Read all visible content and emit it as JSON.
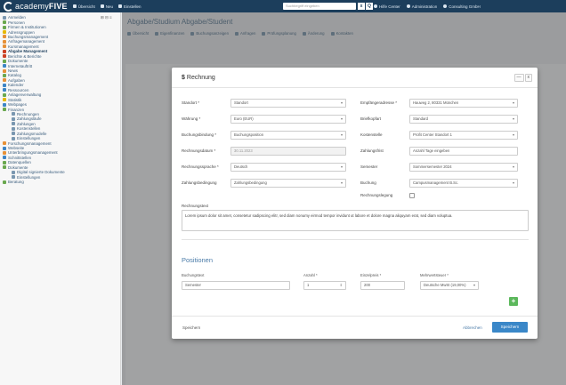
{
  "topbar": {
    "brand_main": "academy",
    "brand_five": "FIVE",
    "nav": [
      "Übersicht",
      "Neu",
      "Einstellen"
    ],
    "search_placeholder": "Suchbegriff eingeben",
    "search_btn_1": "x",
    "search_btn_2": "Q",
    "right": [
      "Hilfe Center",
      "Administration",
      "Consulting GmbH"
    ]
  },
  "sidebar": {
    "tools": "⊞ ⊟ ≡",
    "items": [
      {
        "label": "Anmelden",
        "color": "#7a97b0",
        "bold": false
      },
      {
        "label": "Personen",
        "color": "#6aa84f",
        "bold": false
      },
      {
        "label": "Firmen & Institutionen",
        "color": "#6aa84f",
        "bold": false
      },
      {
        "label": "Adressgruppen",
        "color": "#e6b800",
        "bold": false
      },
      {
        "label": "Buchungsmanagement",
        "color": "#e69138",
        "bold": false
      },
      {
        "label": "Anfragemanagement",
        "color": "#e69138",
        "bold": false
      },
      {
        "label": "Kursmanagement",
        "color": "#e69138",
        "bold": false
      },
      {
        "label": "Abgabe Management",
        "color": "#cc4125",
        "bold": true
      },
      {
        "label": "Berichte & Berichte",
        "color": "#cc4125",
        "bold": false
      },
      {
        "label": "Dokumente",
        "color": "#6aa84f",
        "bold": false
      },
      {
        "label": "Internetauftritt",
        "color": "#3d85c6",
        "bold": false
      },
      {
        "label": "News",
        "color": "#e69138",
        "bold": false
      },
      {
        "label": "Katalog",
        "color": "#6aa84f",
        "bold": false
      },
      {
        "label": "Aufgaben",
        "color": "#e69138",
        "bold": false
      },
      {
        "label": "Kalender",
        "color": "#3d85c6",
        "bold": false
      },
      {
        "label": "Ressourcen",
        "color": "#3d85c6",
        "bold": false
      },
      {
        "label": "Anlagenverwaltung",
        "color": "#6aa84f",
        "bold": false
      },
      {
        "label": "Statistik",
        "color": "#e6b800",
        "bold": false
      },
      {
        "label": "Webpages",
        "color": "#3d85c6",
        "bold": false
      },
      {
        "label": "Finanzen",
        "color": "#6aa84f",
        "bold": false
      },
      {
        "label": "Rechnungen",
        "color": "#7a97b0",
        "bold": false
      },
      {
        "label": "Zahlungsläufe",
        "color": "#7a97b0",
        "bold": false
      },
      {
        "label": "Zahlungen",
        "color": "#7a97b0",
        "bold": false
      },
      {
        "label": "Kostenstellen",
        "color": "#7a97b0",
        "bold": false
      },
      {
        "label": "Zahlungsmodelle",
        "color": "#7a97b0",
        "bold": false
      },
      {
        "label": "Einstellungen",
        "color": "#7a97b0",
        "bold": false
      },
      {
        "label": "Forschungsmanagement",
        "color": "#e69138",
        "bold": false
      },
      {
        "label": "Webseite",
        "color": "#3d85c6",
        "bold": false
      },
      {
        "label": "Unterbringungsmanagement",
        "color": "#e69138",
        "bold": false
      },
      {
        "label": "Schnittstellen",
        "color": "#3d85c6",
        "bold": false
      },
      {
        "label": "Datenquellen",
        "color": "#6aa84f",
        "bold": false
      },
      {
        "label": "Dokumente",
        "color": "#6aa84f",
        "bold": false
      },
      {
        "label": "Digital signierte Dokumente",
        "color": "#7a97b0",
        "bold": false
      },
      {
        "label": "Einstellungen",
        "color": "#7a97b0",
        "bold": false
      },
      {
        "label": "Beratung",
        "color": "#6aa84f",
        "bold": false
      }
    ]
  },
  "main": {
    "title": "Abgabe/Studium Abgabe/Student",
    "subtabs": [
      "Übersicht",
      "Eigenfinanzen",
      "Buchungsanzeigen",
      "Anfragen",
      "Prüfungsplanung",
      "Änderung",
      "Kontakten"
    ]
  },
  "modal": {
    "title": "Rechnung",
    "euro_symbol": "$",
    "hdr_btn_1": "—",
    "hdr_btn_2": "x",
    "left_fields": [
      {
        "label": "Standort *",
        "value": "Standort",
        "select": true,
        "disabled": false
      },
      {
        "label": "Währung *",
        "value": "Euro (EUR)",
        "select": true,
        "disabled": false
      },
      {
        "label": "Buchungsbindung *",
        "value": "Buchungsposition",
        "select": true,
        "disabled": false
      },
      {
        "label": "Rechnungsdatum *",
        "value": "30.11.2023",
        "select": false,
        "disabled": true
      },
      {
        "label": "Rechnungssprache *",
        "value": "Deutsch",
        "select": true,
        "disabled": false
      },
      {
        "label": "Zahlungsbedingung",
        "value": "Zahlungsbedingung",
        "select": true,
        "disabled": false
      }
    ],
    "right_fields": [
      {
        "label": "Empfängeradresse *",
        "value": "Hauweg 2, 80331 München",
        "select": true,
        "disabled": false
      },
      {
        "label": "Briefkopfart",
        "value": "Standard",
        "select": true,
        "disabled": false
      },
      {
        "label": "Kostenstelle",
        "value": "Profit Center Standort 1",
        "select": true,
        "disabled": false
      },
      {
        "label": "Zahlungsfrist",
        "value": "Anzahl Tage eingeben",
        "select": false,
        "disabled": false
      },
      {
        "label": "Semester",
        "value": "Sommersemester 2024",
        "select": true,
        "disabled": false
      },
      {
        "label": "Buchung",
        "value": "Campusmanagement B.Sc.",
        "select": true,
        "disabled": false
      }
    ],
    "checkbox_label": "Rechnungslegung",
    "notes_label": "Rechnungstext",
    "notes_text": "Lorem ipsum dolor sit amet, consetetur sadipscing elitr, sed diam nonumy eirmod tempor invidunt ut labore et dolore magna aliquyam erat, sed diam voluptua.",
    "positions_heading": "Positionen",
    "pos_cols": [
      "Buchungstext",
      "Anzahl *",
      "Einzelpreis *",
      "Mehrwertsteuer *"
    ],
    "pos_values": [
      "Semester",
      "1",
      "200",
      "Deutsche MwSt (19,00%)"
    ],
    "add_symbol": "+",
    "footer_link": "Speichern",
    "footer_cancel": "Abbrechen",
    "footer_save": "Speichern"
  }
}
